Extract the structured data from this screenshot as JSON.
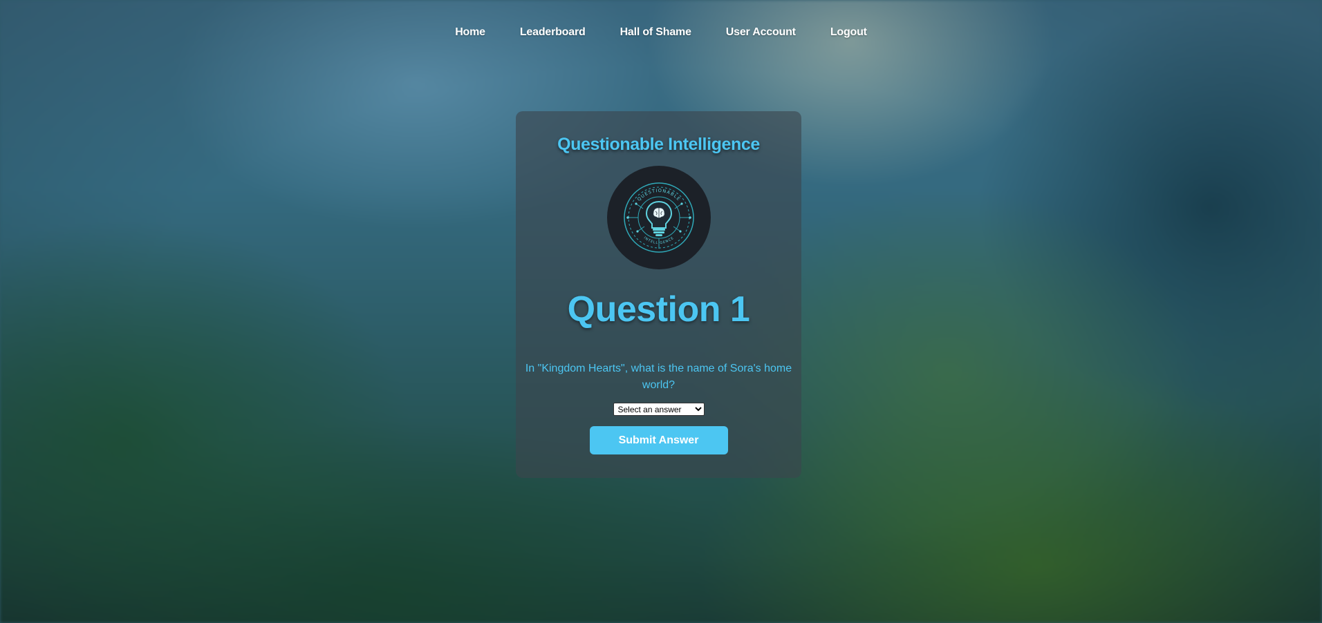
{
  "nav": {
    "items": [
      {
        "label": "Home"
      },
      {
        "label": "Leaderboard"
      },
      {
        "label": "Hall of Shame"
      },
      {
        "label": "User Account"
      },
      {
        "label": "Logout"
      }
    ]
  },
  "card": {
    "brand_title": "Questionable Intelligence",
    "logo": {
      "icon": "lightbulb-brain-emblem",
      "ring_text_top": "QUESTIONABLE",
      "ring_text_bottom": "INTELLIGENCE"
    },
    "question_title": "Question 1",
    "question_text": "In \"Kingdom Hearts\", what is the name of Sora's home world?",
    "answer_select": {
      "selected": "Select an answer"
    },
    "submit_label": "Submit Answer"
  },
  "colors": {
    "accent": "#4cc6f2",
    "card_bg": "rgba(60,70,78,0.62)",
    "logo_bg": "#1c2128"
  }
}
